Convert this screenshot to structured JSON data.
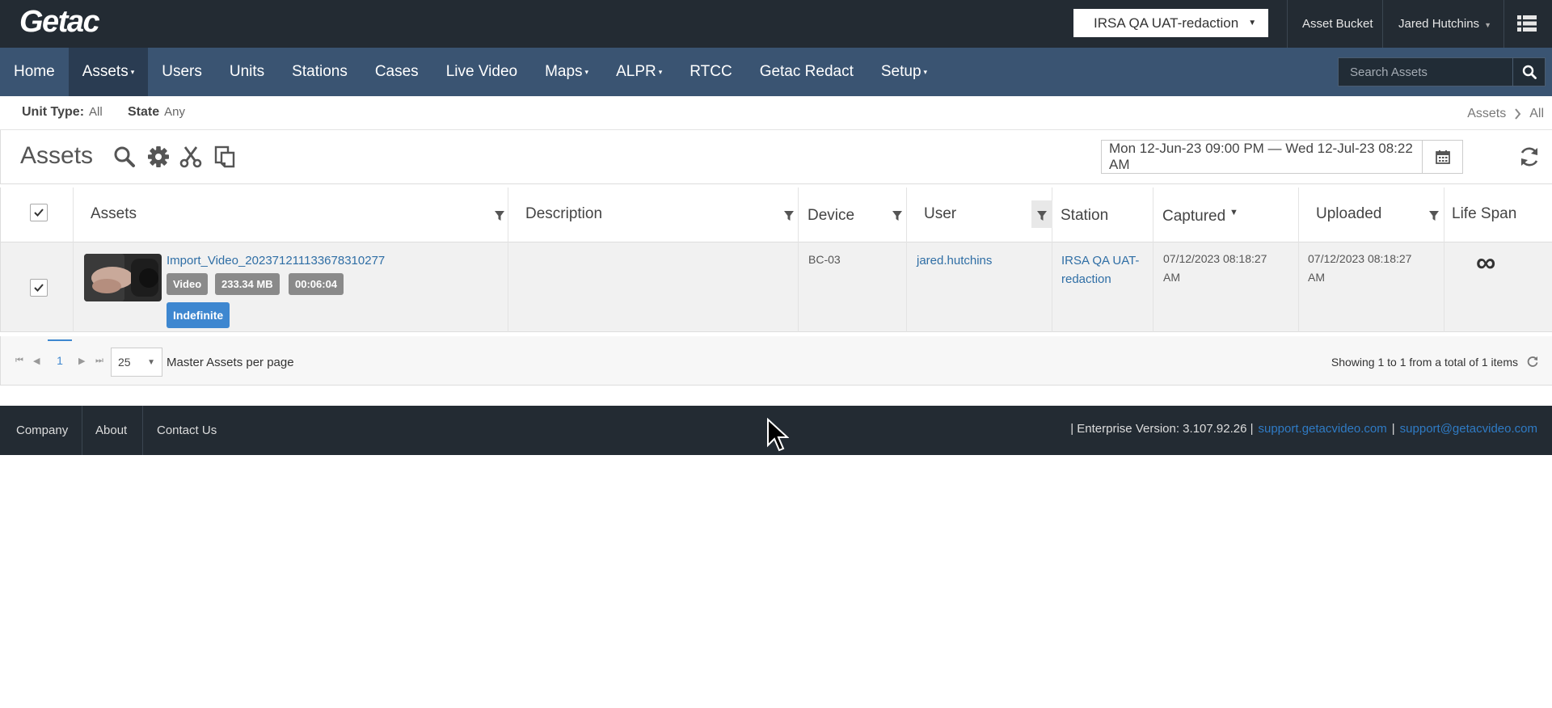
{
  "header": {
    "logo": "Getac",
    "tenant": "IRSA QA UAT-redaction",
    "asset_bucket": "Asset Bucket",
    "user_name": "Jared Hutchins"
  },
  "nav": {
    "items": [
      {
        "label": "Home"
      },
      {
        "label": "Assets",
        "caret": "▾"
      },
      {
        "label": "Users"
      },
      {
        "label": "Units"
      },
      {
        "label": "Stations"
      },
      {
        "label": "Cases"
      },
      {
        "label": "Live Video"
      },
      {
        "label": "Maps",
        "caret": "▾"
      },
      {
        "label": "ALPR",
        "caret": "▾"
      },
      {
        "label": "RTCC"
      },
      {
        "label": "Getac Redact"
      },
      {
        "label": "Setup",
        "caret": "▾"
      }
    ],
    "search_placeholder": "Search Assets"
  },
  "filters": {
    "unit_type_label": "Unit Type:",
    "unit_type_value": "All",
    "state_label": "State",
    "state_value": "Any"
  },
  "breadcrumb": {
    "root": "Assets",
    "current": "All"
  },
  "toolbar": {
    "title": "Assets",
    "date_range": "Mon 12-Jun-23 09:00 PM  —  Wed 12-Jul-23 08:22 AM"
  },
  "table": {
    "columns": {
      "assets": "Assets",
      "description": "Description",
      "device": "Device",
      "user": "User",
      "station": "Station",
      "captured": "Captured",
      "uploaded": "Uploaded",
      "life_span": "Life Span"
    },
    "rows": [
      {
        "asset_name": "Import_Video_202371211133678310277",
        "type": "Video",
        "size": "233.34 MB",
        "duration": "00:06:04",
        "retention": "Indefinite",
        "description": "",
        "device": "BC-03",
        "user": "jared.hutchins",
        "station_line1": "IRSA QA UAT-",
        "station_line2": "redaction",
        "captured_line1": "07/12/2023 08:18:27",
        "captured_line2": "AM",
        "uploaded_line1": "07/12/2023 08:18:27",
        "uploaded_line2": "AM",
        "life_span": "∞"
      }
    ]
  },
  "pager": {
    "current_page": "1",
    "per_page": "25",
    "per_page_label": "Master Assets per page",
    "showing": "Showing 1 to 1 from a total of 1 items"
  },
  "footer": {
    "company": "Company",
    "about": "About",
    "contact": "Contact Us",
    "version": "| Enterprise Version: 3.107.92.26 |",
    "support_url": "support.getacvideo.com",
    "pipe": "|",
    "support_email": "support@getacvideo.com"
  },
  "colors": {
    "topbar": "#232b33",
    "navbar": "#3a5472",
    "link": "#2f6ea5",
    "badge_blue": "#3e87d0"
  }
}
